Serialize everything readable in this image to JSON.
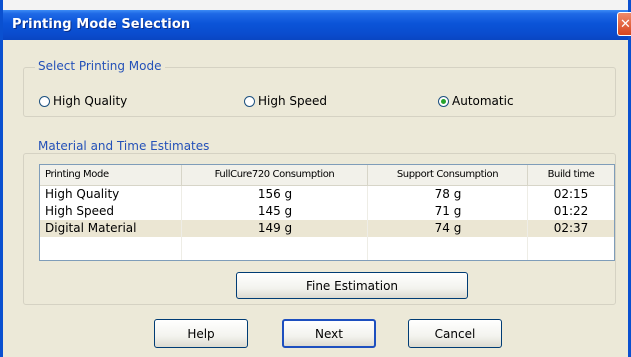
{
  "window": {
    "title": "Printing Mode Selection",
    "close_glyph": "✕",
    "titlebar_color": "#0a4cce"
  },
  "mode_group": {
    "label": "Select Printing Mode",
    "options": [
      {
        "label": "High Quality",
        "checked": false
      },
      {
        "label": "High Speed",
        "checked": false
      },
      {
        "label": "Automatic",
        "checked": true
      }
    ]
  },
  "estimates_group": {
    "label": "Material and Time Estimates",
    "columns": [
      "Printing Mode",
      "FullCure720 Consumption",
      "Support Consumption",
      "Build time"
    ],
    "rows": [
      {
        "mode": "High Quality",
        "fullcure": "156 g",
        "support": "78 g",
        "time": "02:15",
        "selected": false
      },
      {
        "mode": "High Speed",
        "fullcure": "145 g",
        "support": "71 g",
        "time": "01:22",
        "selected": false
      },
      {
        "mode": "Digital Material",
        "fullcure": "149 g",
        "support": "74 g",
        "time": "02:37",
        "selected": true
      }
    ]
  },
  "buttons": {
    "fine_estimation": "Fine Estimation",
    "help": "Help",
    "next": "Next",
    "cancel": "Cancel"
  },
  "icons": {
    "close": "close-icon",
    "radio": "radio-icon"
  }
}
